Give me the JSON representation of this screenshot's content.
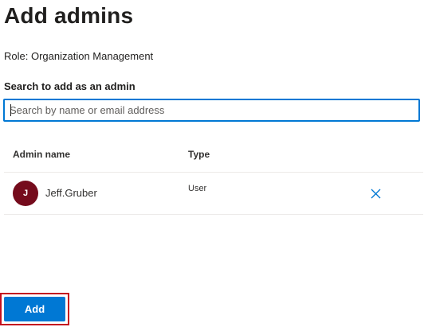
{
  "header": {
    "title": "Add admins",
    "role_text": "Role: Organization Management"
  },
  "search": {
    "label": "Search to add as an admin",
    "placeholder": "Search by name or email address",
    "value": ""
  },
  "table": {
    "columns": [
      "Admin name",
      "Type"
    ],
    "rows": [
      {
        "initial": "J",
        "name": "Jeff.Gruber",
        "type": "User",
        "avatar_color": "#750b1c",
        "remove_icon": "close-icon"
      }
    ]
  },
  "footer": {
    "add_label": "Add"
  },
  "colors": {
    "accent": "#0078d4",
    "highlight_frame": "#c50f1f"
  }
}
